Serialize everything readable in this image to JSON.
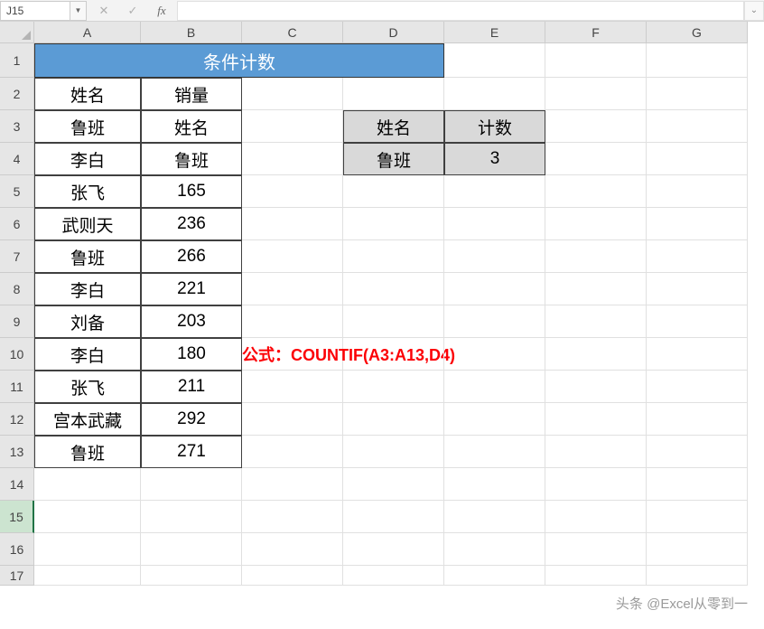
{
  "name_box": "J15",
  "columns": [
    {
      "label": "A",
      "width": 118
    },
    {
      "label": "B",
      "width": 112
    },
    {
      "label": "C",
      "width": 112
    },
    {
      "label": "D",
      "width": 112
    },
    {
      "label": "E",
      "width": 112
    },
    {
      "label": "F",
      "width": 112
    },
    {
      "label": "G",
      "width": 112
    }
  ],
  "rows": [
    {
      "num": 1,
      "height": 38
    },
    {
      "num": 2,
      "height": 36
    },
    {
      "num": 3,
      "height": 36
    },
    {
      "num": 4,
      "height": 36
    },
    {
      "num": 5,
      "height": 36
    },
    {
      "num": 6,
      "height": 36
    },
    {
      "num": 7,
      "height": 36
    },
    {
      "num": 8,
      "height": 36
    },
    {
      "num": 9,
      "height": 36
    },
    {
      "num": 10,
      "height": 36
    },
    {
      "num": 11,
      "height": 36
    },
    {
      "num": 12,
      "height": 36
    },
    {
      "num": 13,
      "height": 36
    },
    {
      "num": 14,
      "height": 36
    },
    {
      "num": 15,
      "height": 36
    },
    {
      "num": 16,
      "height": 36
    },
    {
      "num": 17,
      "height": 22
    }
  ],
  "title_merged": "条件计数",
  "table_main": {
    "headers": [
      "姓名",
      "销量"
    ],
    "rows": [
      [
        "鲁班",
        "姓名"
      ],
      [
        "李白",
        "鲁班"
      ],
      [
        "张飞",
        "165"
      ],
      [
        "武则天",
        "236"
      ],
      [
        "鲁班",
        "266"
      ],
      [
        "李白",
        "221"
      ],
      [
        "刘备",
        "203"
      ],
      [
        "李白",
        "180"
      ],
      [
        "张飞",
        "211"
      ],
      [
        "宫本武藏",
        "292"
      ],
      [
        "鲁班",
        "271"
      ]
    ]
  },
  "table_lookup": {
    "headers": [
      "姓名",
      "计数"
    ],
    "values": [
      "鲁班",
      "3"
    ]
  },
  "formula_label": "公式：COUNTIF(A3:A13,D4)",
  "watermark": "头条 @Excel从零到一",
  "active_row": 15
}
